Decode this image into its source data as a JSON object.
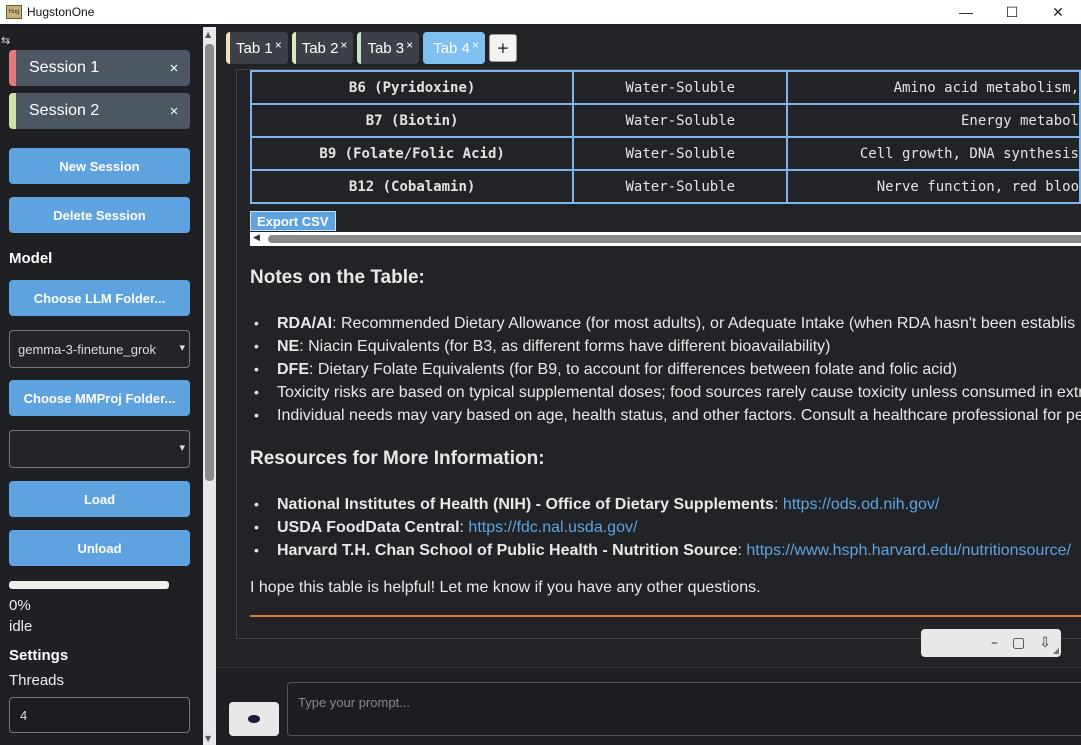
{
  "window": {
    "title": "HugstonOne",
    "icon_text": "Hug",
    "controls": {
      "minimize": "—",
      "maximize": "☐",
      "close": "✕"
    }
  },
  "sidebar": {
    "toggle_icon": "⇆",
    "sessions": [
      {
        "label": "Session 1",
        "close": "×",
        "color": "#e07a7a"
      },
      {
        "label": "Session 2",
        "close": "×",
        "color": "#cfe3a8"
      }
    ],
    "new_session": "New Session",
    "delete_session": "Delete Session",
    "model_title": "Model",
    "choose_llm": "Choose LLM Folder...",
    "llm_selected": "gemma-3-finetune_grok",
    "choose_mmproj": "Choose MMProj Folder...",
    "mmproj_selected": "",
    "load": "Load",
    "unload": "Unload",
    "progress_value": 0,
    "progress_text": "0%",
    "status": "idle",
    "settings_title": "Settings",
    "threads_label": "Threads",
    "threads_value": "4"
  },
  "tabs": [
    {
      "label": "Tab 1",
      "close": "×",
      "color": "#f2e2b8",
      "active": false
    },
    {
      "label": "Tab 2",
      "close": "×",
      "color": "#d8ecc0",
      "active": false
    },
    {
      "label": "Tab 3",
      "close": "×",
      "color": "#bfe6c8",
      "active": false
    },
    {
      "label": "Tab 4",
      "close": "×",
      "color": "#7fc0f0",
      "active": true
    }
  ],
  "tab_add": "+",
  "table": {
    "rows": [
      [
        "B6 (Pyridoxine)",
        "Water-Soluble",
        "Amino acid metabolism,"
      ],
      [
        "B7 (Biotin)",
        "Water-Soluble",
        "Energy metabol"
      ],
      [
        "B9 (Folate/Folic Acid)",
        "Water-Soluble",
        "Cell growth, DNA synthesis"
      ],
      [
        "B12 (Cobalamin)",
        "Water-Soluble",
        "Nerve function, red bloo"
      ]
    ],
    "export": "Export CSV"
  },
  "notes": {
    "title": "Notes on the Table:",
    "items": [
      {
        "bold": "RDA/AI",
        "text": ": Recommended Dietary Allowance (for most adults), or Adequate Intake (when RDA hasn't been establis"
      },
      {
        "bold": "NE",
        "text": ": Niacin Equivalents (for B3, as different forms have different bioavailability)"
      },
      {
        "bold": "DFE",
        "text": ": Dietary Folate Equivalents (for B9, to account for differences between folate and folic acid)"
      },
      {
        "bold": "",
        "text": "Toxicity risks are based on typical supplemental doses; food sources rarely cause toxicity unless consumed in extr"
      },
      {
        "bold": "",
        "text": "Individual needs may vary based on age, health status, and other factors. Consult a healthcare professional for pe"
      }
    ]
  },
  "resources": {
    "title": "Resources for More Information:",
    "items": [
      {
        "bold": "National Institutes of Health (NIH) - Office of Dietary Supplements",
        "sep": ": ",
        "link": "https://ods.od.nih.gov/"
      },
      {
        "bold": "USDA FoodData Central",
        "sep": ": ",
        "link": "https://fdc.nal.usda.gov/"
      },
      {
        "bold": "Harvard T.H. Chan School of Public Health - Nutrition Source",
        "sep": ": ",
        "link": "https://www.hsph.harvard.edu/nutritionsource/"
      }
    ]
  },
  "closing": "I hope this table is helpful! Let me know if you have any other questions.",
  "mini_controls": {
    "minimize": "–",
    "restore": "▢",
    "download": "⇩",
    "grip": "◢"
  },
  "prompt": {
    "placeholder": "Type your prompt..."
  },
  "colors": {
    "accent": "#5ea3e0",
    "divider": "#d97a2b"
  }
}
